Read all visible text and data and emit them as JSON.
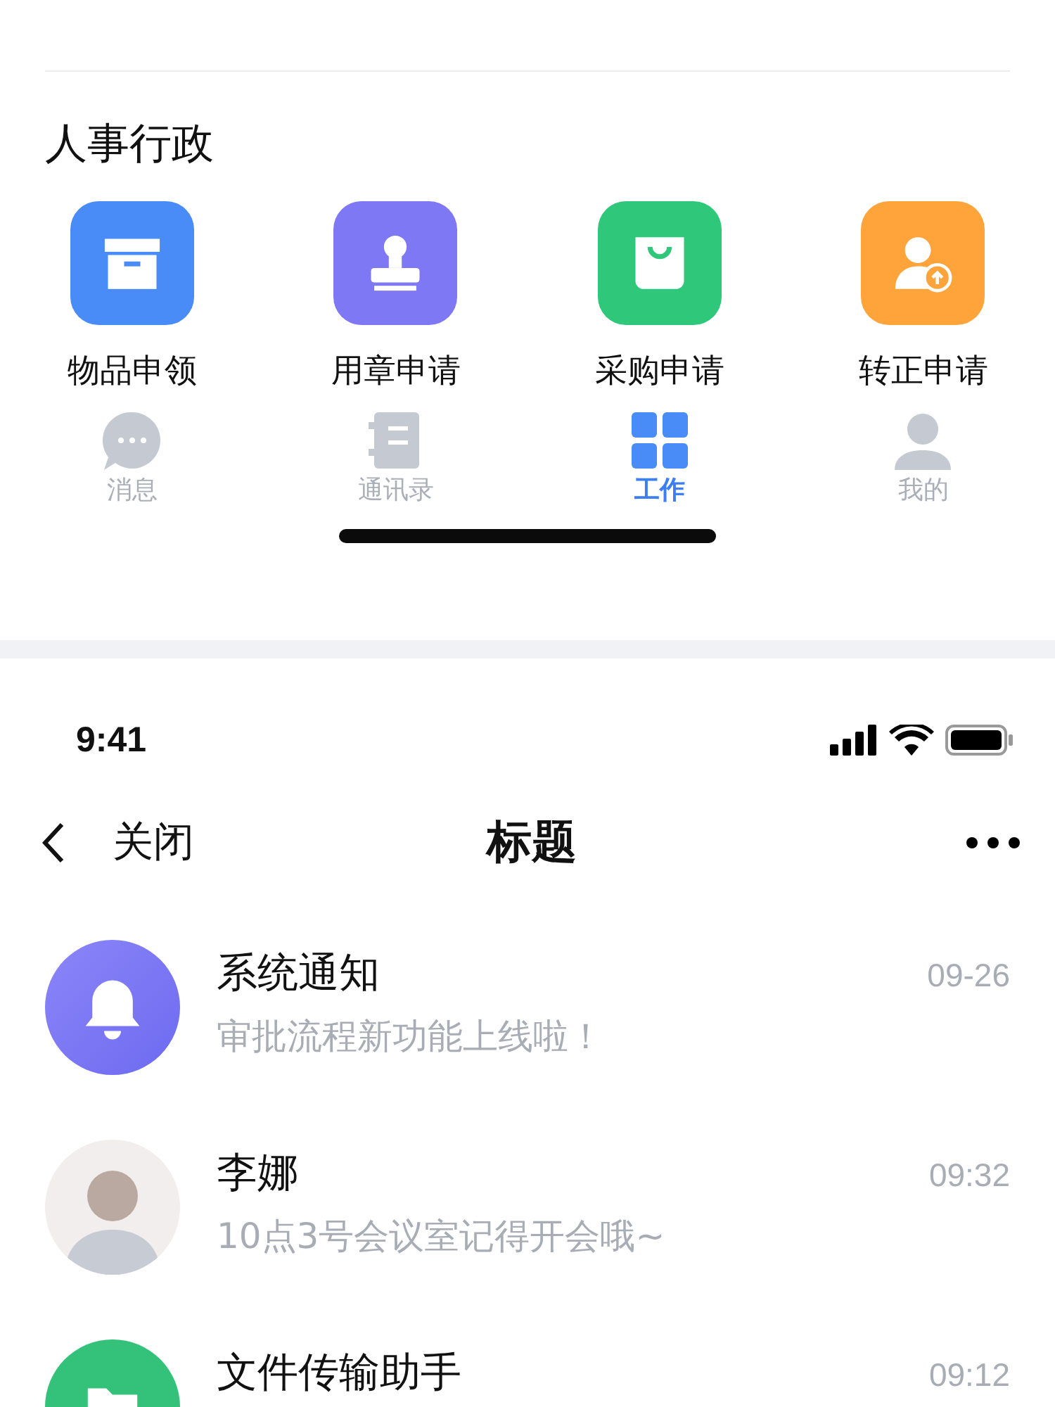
{
  "section": {
    "title": "人事行政"
  },
  "apps": [
    {
      "label": "物品申领",
      "kind": "box",
      "color": "#4a8cf7"
    },
    {
      "label": "用章申请",
      "kind": "stamp",
      "color": "#7f78f5"
    },
    {
      "label": "采购申请",
      "kind": "bag",
      "color": "#2fc77a"
    },
    {
      "label": "转正申请",
      "kind": "user",
      "color": "#ffa43a"
    }
  ],
  "tabs": [
    {
      "label": "消息",
      "kind": "chat",
      "selected": false
    },
    {
      "label": "通讯录",
      "kind": "book",
      "selected": false
    },
    {
      "label": "工作",
      "kind": "grid",
      "selected": true
    },
    {
      "label": "我的",
      "kind": "person",
      "selected": false
    }
  ],
  "status_bar": {
    "time": "9:41"
  },
  "nav": {
    "back": "关闭",
    "title": "标题"
  },
  "messages": [
    {
      "kind": "bell",
      "title": "系统通知",
      "subtitle": "审批流程新功能上线啦！",
      "time": "09-26"
    },
    {
      "kind": "photo",
      "title": "李娜",
      "subtitle": "10点3号会议室记得开会哦~",
      "time": "09:32"
    },
    {
      "kind": "folder",
      "title": "文件传输助手",
      "time": "09:12"
    }
  ]
}
